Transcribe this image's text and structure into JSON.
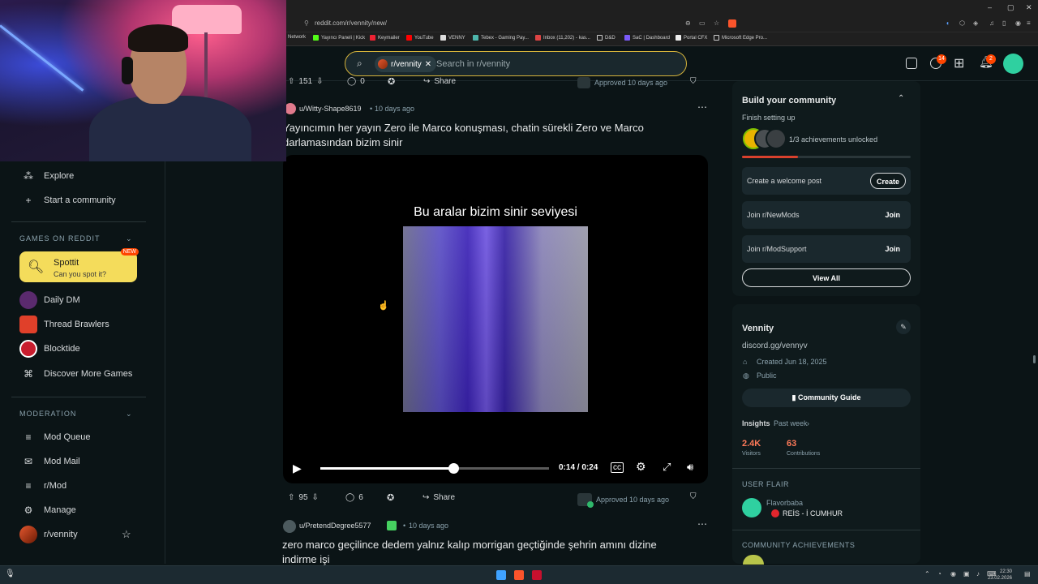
{
  "browser": {
    "url": "reddit.com/r/vennity/new/",
    "bookmarks": [
      "Network",
      "Yayıncı Paneli | Kick",
      "Keymailer",
      "YouTube",
      "VENNY",
      "Tebex - Gaming Pay...",
      "Inbox (11,202) - kas...",
      "D&D",
      "SaC | Dashboard",
      "Portal CFX",
      "Microsoft Edge Pro..."
    ],
    "badges": {
      "chat": "14",
      "notifications": "2"
    }
  },
  "search": {
    "chip": "r/vennity",
    "placeholder": "Search in r/vennity"
  },
  "leftnav": {
    "explore": "Explore",
    "start_community": "Start a community",
    "games_header": "GAMES ON REDDIT",
    "spottit_title": "Spottit",
    "spottit_sub": "Can you spot it?",
    "spottit_badge": "NEW",
    "games": [
      "Daily DM",
      "Thread Brawlers",
      "Blocktide",
      "Discover More Games"
    ],
    "moderation_header": "MODERATION",
    "mod_items": [
      "Mod Queue",
      "Mod Mail",
      "r/Mod",
      "Manage"
    ],
    "community": "r/vennity"
  },
  "prev_post": {
    "votes": "151",
    "comments": "0",
    "share": "Share",
    "status": "Approved 10 days ago"
  },
  "post": {
    "author": "u/Witty-Shape8619",
    "age": "10 days ago",
    "title_line1": "Yayıncımın her yayın Zero ile Marco konuşması, chatin sürekli Zero ve Marco",
    "title_line2": "darlamasından bizim sinir",
    "video_caption": "Bu aralar bizim sinir seviyesi",
    "time": "0:14 / 0:24",
    "progress": 0.58,
    "votes": "95",
    "comments": "6",
    "share": "Share",
    "status": "Approved 10 days ago"
  },
  "next_post": {
    "author": "u/PretendDegree5577",
    "age": "10 days ago",
    "title_line1": "zero marco geçilince dedem yalnız kalıp morrigan geçtiğinde şehrin amını dizine",
    "title_line2": "indirme işi"
  },
  "rightbar": {
    "build_title": "Build your community",
    "finish": "Finish setting up",
    "achievements": "1/3 achievements unlocked",
    "achievement_progress": 0.33,
    "tasks": [
      {
        "label": "Create a welcome post",
        "button": "Create"
      },
      {
        "label": "Join r/NewMods",
        "button": "Join"
      },
      {
        "label": "Join r/ModSupport",
        "button": "Join"
      }
    ],
    "view_all": "View All",
    "community_name": "Vennity",
    "community_link": "discord.gg/vennyv",
    "created": "Created Jun 18, 2025",
    "visibility": "Public",
    "guide": "Community Guide",
    "insights": "Insights",
    "insights_period": "Past week",
    "visitors_value": "2.4K",
    "visitors_label": "Visitors",
    "contrib_value": "63",
    "contrib_label": "Contributions",
    "user_flair_header": "USER FLAIR",
    "flair_user": "Flavorbaba",
    "flair_text": "REİS - İ CUMHUR",
    "community_achievements": "COMMUNITY ACHIEVEMENTS"
  },
  "taskbar": {
    "time": "22:30",
    "date": "23.02.2026"
  },
  "colors": {
    "accent": "#ff4500",
    "bg": "#0b1416",
    "card": "#0f1a1c",
    "spottit": "#f4dc5b"
  }
}
